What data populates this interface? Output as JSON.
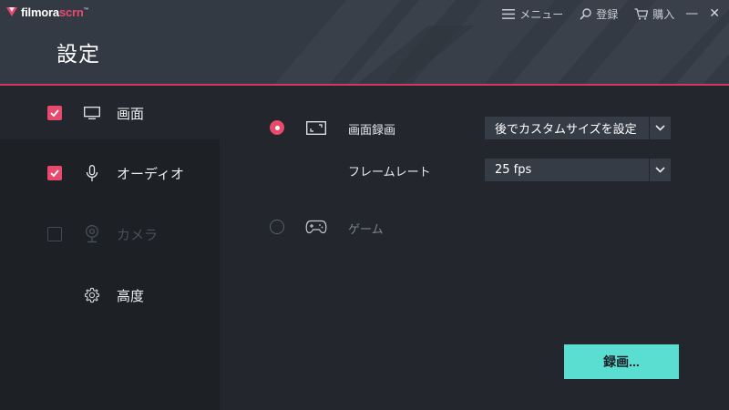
{
  "app": {
    "logo_primary": "filmora",
    "logo_accent": "scrn",
    "logo_mark": "™"
  },
  "header": {
    "title": "設定",
    "menu_label": "メニュー",
    "login_label": "登録",
    "buy_label": "購入",
    "minimize_label": "—",
    "close_label": "✕"
  },
  "sidebar": {
    "items": [
      {
        "label": "画面",
        "icon": "monitor-icon",
        "checked": true,
        "active": true
      },
      {
        "label": "オーディオ",
        "icon": "microphone-icon",
        "checked": true,
        "active": false
      },
      {
        "label": "カメラ",
        "icon": "webcam-icon",
        "checked": false,
        "active": false,
        "disabled": true
      },
      {
        "label": "高度",
        "icon": "gear-icon",
        "active": false
      }
    ]
  },
  "screen_options": {
    "screen_record": {
      "label": "画面録画",
      "selected": true,
      "size_value": "後でカスタムサイズを設定"
    },
    "frame_rate": {
      "label": "フレームレート",
      "value": "25 fps"
    },
    "game": {
      "label": "ゲーム",
      "selected": false
    }
  },
  "actions": {
    "record_label": "録画..."
  },
  "colors": {
    "accent": "#e84a6d",
    "record_button": "#5bded2",
    "header_bg": "#333a43",
    "sidebar_bg": "#1d2025",
    "main_bg": "#23272d",
    "select_bg": "#363c45"
  }
}
